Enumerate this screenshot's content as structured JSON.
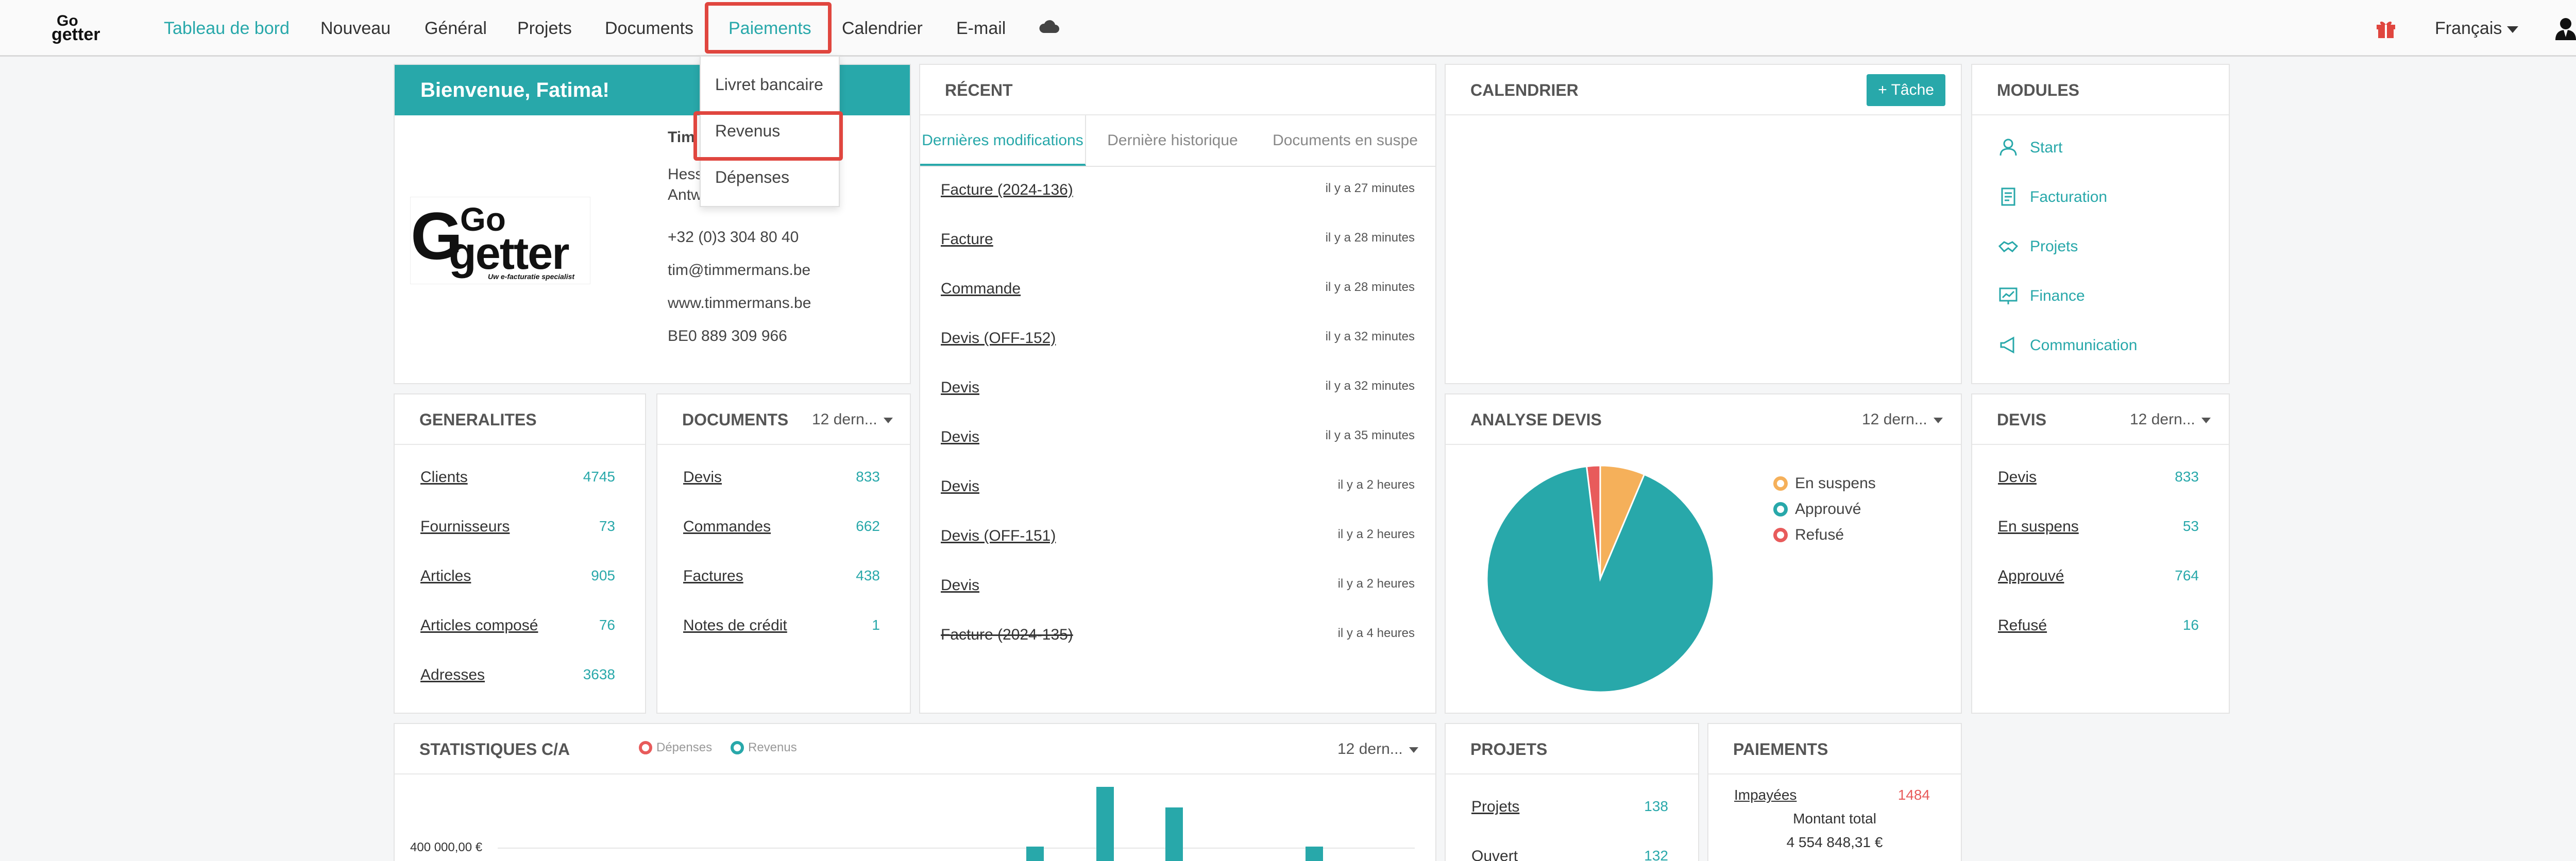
{
  "nav": {
    "logo_go": "Go",
    "logo_getter": "getter",
    "items": [
      "Tableau de bord",
      "Nouveau",
      "Général",
      "Projets",
      "Documents",
      "Paiements",
      "Calendrier",
      "E-mail"
    ],
    "language": "Français",
    "icons": {
      "cloud": "cloud-icon",
      "gift": "gift-icon",
      "user": "user-icon"
    }
  },
  "dropdown": {
    "items": [
      "Livret bancaire",
      "Revenus",
      "Dépenses"
    ]
  },
  "welcome": {
    "title": "Bienvenue, Fatima!",
    "name_partial": "Tim",
    "address_line1": "Hess",
    "address_line2": "Antw",
    "phone": "+32 (0)3 304 80 40",
    "email": "tim@timmermans.be",
    "website": "www.timmermans.be",
    "vat": "BE0 889 309 966",
    "logo_g": "G",
    "logo_go": "Go",
    "logo_getter": "getter",
    "logo_tagline": "Uw e-facturatie specialist"
  },
  "recent": {
    "title": "RÉCENT",
    "tabs": [
      "Dernières modifications",
      "Dernière historique",
      "Documents en suspe"
    ],
    "rows": [
      {
        "doc": "Facture (2024-136)",
        "when": "il y a 27 minutes"
      },
      {
        "doc": "Facture",
        "when": "il y a 28 minutes"
      },
      {
        "doc": "Commande",
        "when": "il y a 28 minutes"
      },
      {
        "doc": "Devis (OFF-152)",
        "when": "il y a 32 minutes"
      },
      {
        "doc": "Devis",
        "when": "il y a 32 minutes"
      },
      {
        "doc": "Devis",
        "when": "il y a 35 minutes"
      },
      {
        "doc": "Devis",
        "when": "il y a 2 heures"
      },
      {
        "doc": "Devis (OFF-151)",
        "when": "il y a 2 heures"
      },
      {
        "doc": "Devis",
        "when": "il y a 2 heures"
      },
      {
        "doc": "Facture (2024-135)",
        "when": "il y a 4 heures"
      }
    ]
  },
  "calendar": {
    "title": "CALENDRIER",
    "task_button": "+ Tâche"
  },
  "modules": {
    "title": "MODULES",
    "items": [
      "Start",
      "Facturation",
      "Projets",
      "Finance",
      "Communication"
    ]
  },
  "generalites": {
    "title": "GENERALITES",
    "rows": [
      {
        "label": "Clients",
        "value": "4745"
      },
      {
        "label": "Fournisseurs",
        "value": "73"
      },
      {
        "label": "Articles",
        "value": "905"
      },
      {
        "label": "Articles composé",
        "value": "76"
      },
      {
        "label": "Adresses",
        "value": "3638"
      }
    ]
  },
  "documents": {
    "title": "DOCUMENTS",
    "period": "12 dern...",
    "rows": [
      {
        "label": "Devis",
        "value": "833"
      },
      {
        "label": "Commandes",
        "value": "662"
      },
      {
        "label": "Factures",
        "value": "438"
      },
      {
        "label": "Notes de crédit",
        "value": "1"
      }
    ]
  },
  "analyse": {
    "title": "ANALYSE DEVIS",
    "period": "12 dern...",
    "legend": [
      {
        "label": "En suspens",
        "color": "#f5b05a"
      },
      {
        "label": "Approuvé",
        "color": "#28a8aa"
      },
      {
        "label": "Refusé",
        "color": "#e85b5b"
      }
    ]
  },
  "devis": {
    "title": "DEVIS",
    "period": "12 dern...",
    "rows": [
      {
        "label": "Devis",
        "value": "833"
      },
      {
        "label": "En suspens",
        "value": "53"
      },
      {
        "label": "Approuvé",
        "value": "764"
      },
      {
        "label": "Refusé",
        "value": "16"
      }
    ]
  },
  "stats": {
    "title": "STATISTIQUES C/A",
    "period": "12 dern...",
    "legend_depenses": "Dépenses",
    "legend_revenus": "Revenus",
    "axis_label": "400 000,00 €"
  },
  "projets": {
    "title": "PROJETS",
    "rows": [
      {
        "label": "Projets",
        "value": "138"
      },
      {
        "label": "Ouvert",
        "value": "132"
      }
    ]
  },
  "paiements": {
    "title": "PAIEMENTS",
    "unpaid_label": "Impayées",
    "unpaid_value": "1484",
    "total_label": "Montant total",
    "total_value": "4 554 848,31 €"
  },
  "chart_data": {
    "type": "pie",
    "categories": [
      "En suspens",
      "Approuvé",
      "Refusé"
    ],
    "values": [
      53,
      764,
      16
    ],
    "colors": [
      "#f5b05a",
      "#28a8aa",
      "#e85b5b"
    ],
    "legend_position": "right"
  }
}
